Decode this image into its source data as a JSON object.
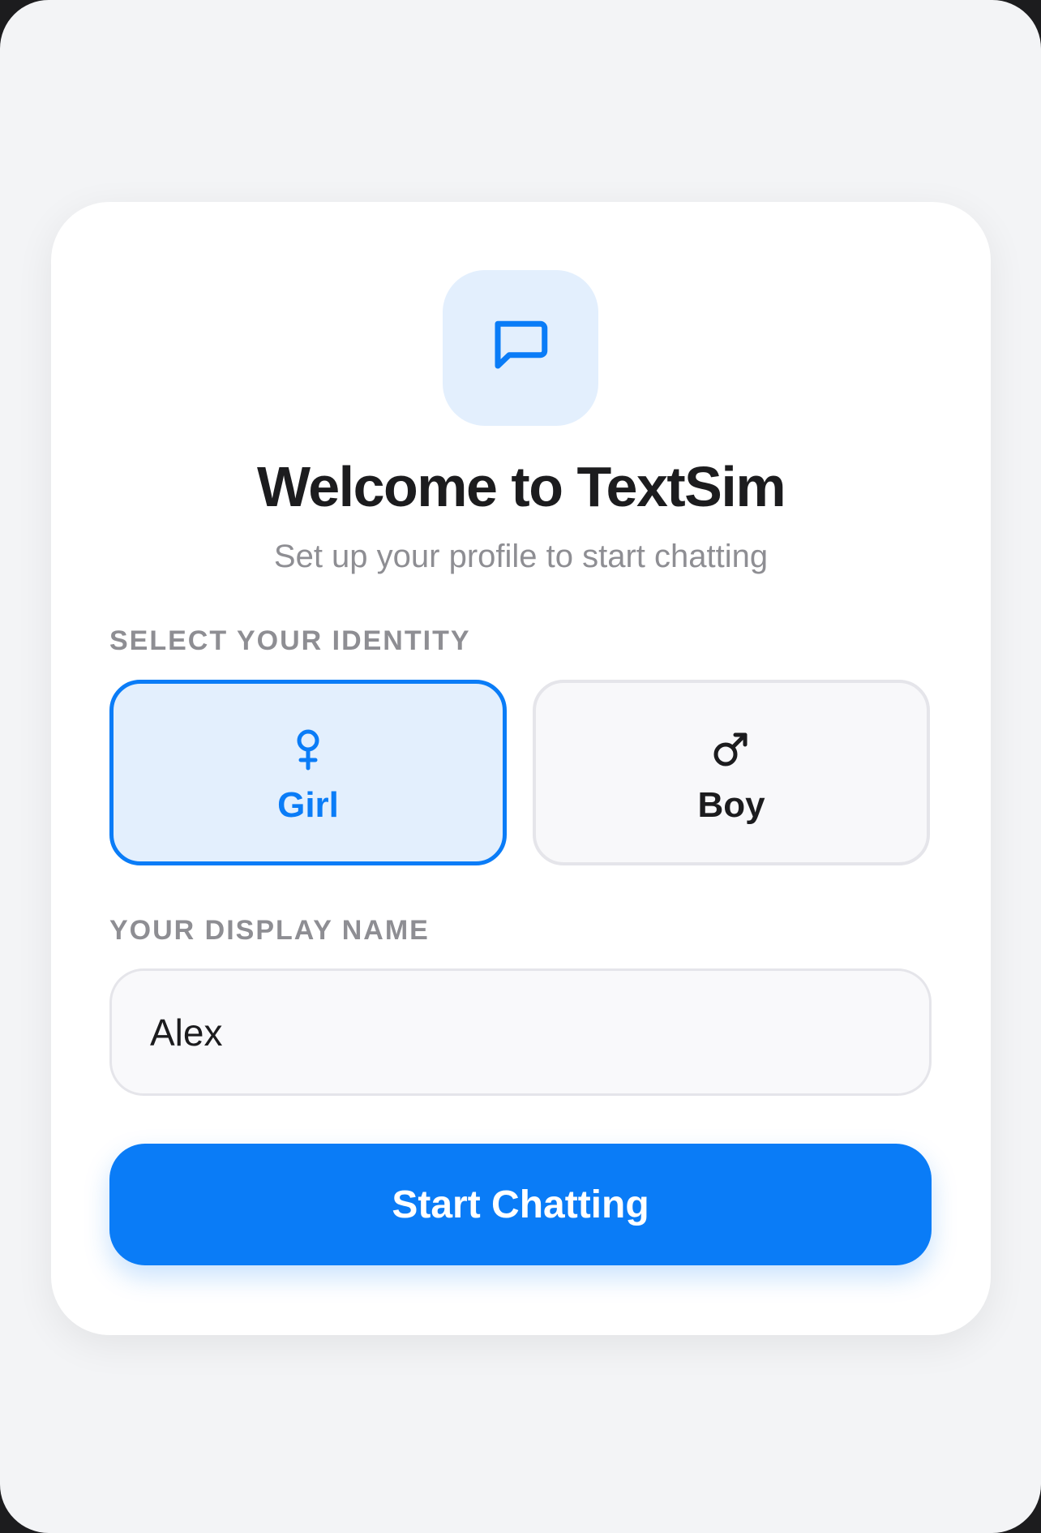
{
  "app": {
    "title": "Welcome to TextSim",
    "subtitle": "Set up your profile to start chatting",
    "logo_icon": "chat-bubble-icon",
    "accent_color": "#0a7cf7"
  },
  "identity": {
    "label": "SELECT YOUR IDENTITY",
    "selected": "Girl",
    "options": [
      {
        "label": "Girl",
        "icon": "female-symbol-icon"
      },
      {
        "label": "Boy",
        "icon": "male-symbol-icon"
      }
    ]
  },
  "display_name": {
    "label": "YOUR DISPLAY NAME",
    "value": "Alex"
  },
  "actions": {
    "start_label": "Start Chatting"
  }
}
